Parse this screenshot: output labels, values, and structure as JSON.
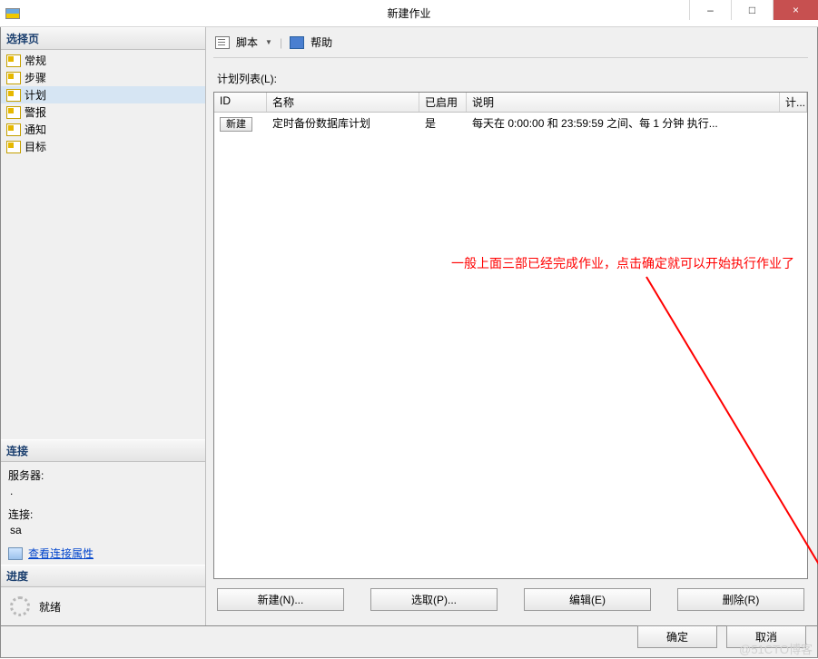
{
  "window": {
    "title": "新建作业",
    "minimize": "–",
    "maximize": "□",
    "close": "×"
  },
  "sidebar": {
    "pages_header": "选择页",
    "pages": [
      {
        "label": "常规"
      },
      {
        "label": "步骤"
      },
      {
        "label": "计划"
      },
      {
        "label": "警报"
      },
      {
        "label": "通知"
      },
      {
        "label": "目标"
      }
    ],
    "selected_index": 2,
    "conn_header": "连接",
    "server_label": "服务器:",
    "server_value": ".",
    "conn_label": "连接:",
    "conn_value": "sa",
    "view_conn_props": "查看连接属性",
    "progress_header": "进度",
    "status_text": "就绪"
  },
  "toolbar": {
    "script": "脚本",
    "help": "帮助"
  },
  "list": {
    "label": "计划列表(L):",
    "columns": {
      "id": "ID",
      "name": "名称",
      "enabled": "已启用",
      "desc": "说明",
      "last": "计..."
    },
    "rows": [
      {
        "id_btn": "新建",
        "name": "定时备份数据库计划",
        "enabled": "是",
        "desc": "每天在 0:00:00 和 23:59:59 之间、每 1 分钟 执行..."
      }
    ]
  },
  "annotation": "一般上面三部已经完成作业，点击确定就可以开始执行作业了",
  "action_buttons": {
    "new": "新建(N)...",
    "pick": "选取(P)...",
    "edit": "编辑(E)",
    "delete": "删除(R)"
  },
  "dialog": {
    "ok": "确定",
    "cancel": "取消"
  },
  "watermark": "@51CTO博客"
}
